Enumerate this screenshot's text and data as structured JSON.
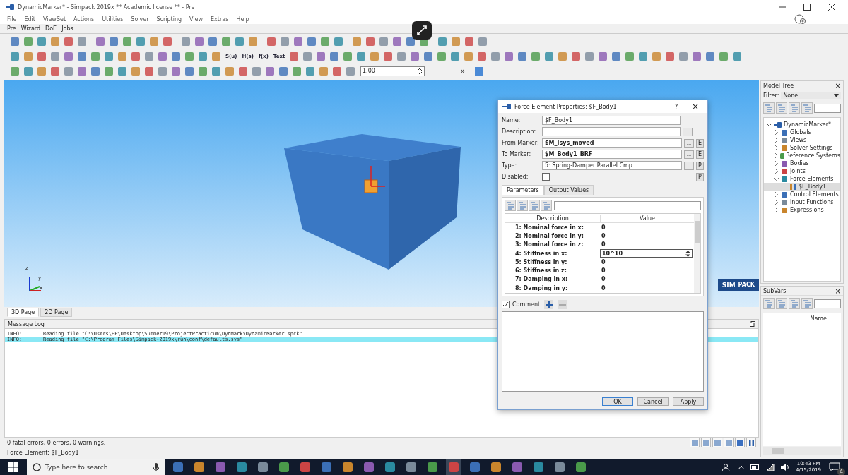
{
  "window": {
    "title": "DynamicMarker* - Simpack 2019x  **  Academic license  ** - Pre"
  },
  "menu": [
    "File",
    "Edit",
    "ViewSet",
    "Actions",
    "Utilities",
    "Solver",
    "Scripting",
    "View",
    "Extras",
    "Help"
  ],
  "submenu": [
    "Pre",
    "Wizard",
    "DoE",
    "Jobs"
  ],
  "toolbar_text_buttons": [
    "S(u)",
    "H(s)",
    "f(x)",
    "Text"
  ],
  "zoom_field": {
    "value": "1.00"
  },
  "toolbar_more": "»",
  "viewport": {
    "logo": [
      "SIM",
      "PACK"
    ],
    "axes": [
      "z",
      "y",
      "x"
    ]
  },
  "page_tabs": [
    {
      "label": "3D Page",
      "selected": true
    },
    {
      "label": "2D Page",
      "selected": false
    }
  ],
  "dialog": {
    "title": "Force Element Properties: $F_Body1",
    "help": "?",
    "close": "×",
    "fields": [
      {
        "label": "Name:",
        "value": "$F_Body1",
        "bold": false,
        "browse": false
      },
      {
        "label": "Description:",
        "browse": true
      },
      {
        "label": "From Marker:",
        "value": "$M_Isys_moved",
        "bold": true,
        "browse": true,
        "side": "E"
      },
      {
        "label": "To Marker:",
        "value": "$M_Body1_BRF",
        "bold": true,
        "browse": true,
        "side": "E"
      },
      {
        "label": "Type:",
        "value": "5: Spring-Damper Parallel Cmp",
        "bold": false,
        "browse": true,
        "side": "P"
      }
    ],
    "browse_label": "...",
    "disabled": {
      "label": "Disabled:",
      "checked": false,
      "side": "P"
    },
    "tabs": [
      {
        "label": "Parameters",
        "selected": true
      },
      {
        "label": "Output Values",
        "selected": false
      }
    ],
    "columns": [
      "Description",
      "Value"
    ],
    "rows": [
      {
        "description": "1: Nominal force in x:",
        "value": "0",
        "editing": false
      },
      {
        "description": "2: Nominal force in y:",
        "value": "0",
        "editing": false
      },
      {
        "description": "3: Nominal force in z:",
        "value": "0",
        "editing": false
      },
      {
        "description": "4: Stiffness in x:",
        "value": "10^10",
        "editing": true
      },
      {
        "description": "5: Stiffness in y:",
        "value": "0",
        "editing": false
      },
      {
        "description": "6: Stiffness in z:",
        "value": "0",
        "editing": false
      },
      {
        "description": "7: Damping in x:",
        "value": "0",
        "editing": false
      },
      {
        "description": "8: Damping in y:",
        "value": "0",
        "editing": false
      }
    ],
    "comment": {
      "label": "Comment",
      "checked": true
    },
    "buttons": [
      "OK",
      "Cancel",
      "Apply"
    ]
  },
  "message_log": {
    "title": "Message Log",
    "lines": [
      {
        "level": "INFO:",
        "text": "Reading file \"C:\\Users\\HP\\Desktop\\Summer19\\ProjectPracticum\\DynMark\\DynamicMarker.spck\"",
        "selected": false
      },
      {
        "level": "INFO:",
        "text": "Reading file \"C:\\Program Files\\Simpack-2019x\\run\\conf\\defaults.sys\"",
        "selected": true
      }
    ]
  },
  "status": [
    "0 fatal errors, 0 errors, 0 warnings.",
    "Force Element: $F_Body1"
  ],
  "model_tree": {
    "title": "Model Tree",
    "close": "×",
    "filter_label": "Filter:",
    "filter_value": "None",
    "items": [
      {
        "label": "DynamicMarker*",
        "expanded": true,
        "selected": false,
        "children": [
          {
            "label": "Globals",
            "expanded": false,
            "selected": false
          },
          {
            "label": "Views",
            "expanded": false,
            "selected": false
          },
          {
            "label": "Solver Settings",
            "expanded": false,
            "selected": false
          },
          {
            "label": "Reference Systems",
            "expanded": false,
            "selected": false
          },
          {
            "label": "Bodies",
            "expanded": false,
            "selected": false
          },
          {
            "label": "Joints",
            "expanded": false,
            "selected": false
          },
          {
            "label": "Force Elements",
            "expanded": true,
            "selected": false,
            "children": [
              {
                "label": "$F_Body1",
                "selected": true
              }
            ]
          },
          {
            "label": "Control Elements",
            "expanded": false,
            "selected": false
          },
          {
            "label": "Input Functions",
            "expanded": false,
            "selected": false
          },
          {
            "label": "Expressions",
            "expanded": false,
            "selected": false
          }
        ]
      }
    ]
  },
  "subvars": {
    "title": "SubVars",
    "close": "×",
    "column": "Name"
  },
  "taskbar": {
    "search_placeholder": "Type here to search",
    "time": "10:43 PM",
    "date": "4/15/2019",
    "notifications": "4"
  }
}
